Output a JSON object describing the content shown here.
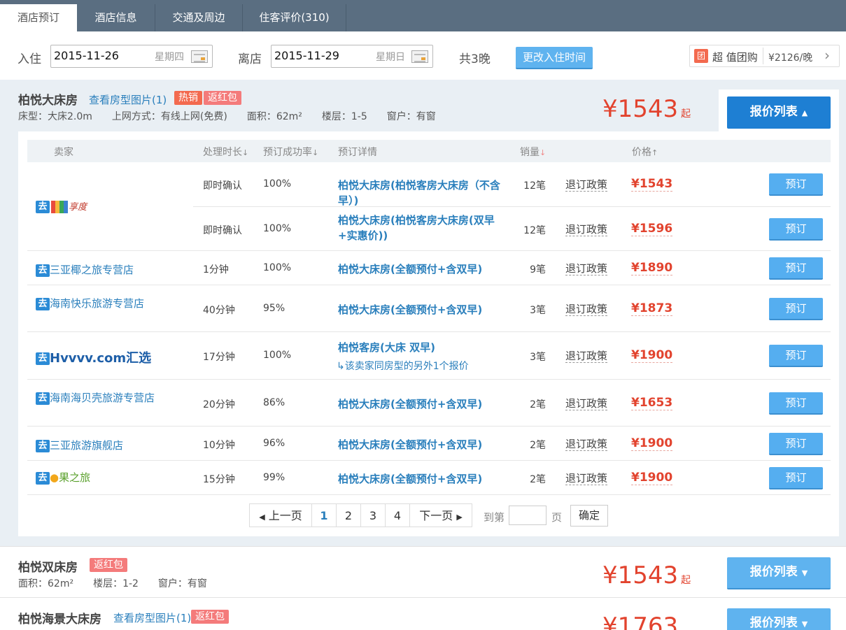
{
  "tabs": [
    {
      "label": "酒店预订"
    },
    {
      "label": "酒店信息"
    },
    {
      "label": "交通及周边"
    },
    {
      "label": "住客评价(310)"
    }
  ],
  "dates": {
    "checkin_label": "入住",
    "checkin_date": "2015-11-26",
    "checkin_weekday": "星期四",
    "checkout_label": "离店",
    "checkout_date": "2015-11-29",
    "checkout_weekday": "星期日",
    "nights": "共3晚",
    "change_button": "更改入住时间"
  },
  "promo": {
    "icon": "团",
    "label": "超 值团购",
    "price": "¥2126/晚"
  },
  "room1": {
    "name": "柏悦大床房",
    "view_photos": "查看房型图片(1)",
    "tag_hot": "热销",
    "tag_redpack": "返红包",
    "specs": "床型：大床2.0m　　上网方式：有线上网(免费)　　面积：62m²　　楼层：1-5　　窗户：有窗",
    "price": "¥1543",
    "price_suffix": "起",
    "quote_button": "报价列表"
  },
  "table": {
    "headers": {
      "seller": "卖家",
      "time": "处理时长",
      "rate": "预订成功率",
      "detail": "预订详情",
      "sales": "销量",
      "price": "价格"
    },
    "book_label": "预订",
    "policy_label": "退订政策",
    "rows": [
      {
        "seller": "享度",
        "time": "即时确认",
        "rate": "100%",
        "detail": "柏悦大床房(柏悦客房大床房（不含早）)",
        "sales": "12笔",
        "price": "¥1543"
      },
      {
        "seller": "",
        "time": "即时确认",
        "rate": "100%",
        "detail": "柏悦大床房(柏悦客房大床房(双早+实惠价))",
        "sales": "12笔",
        "price": "¥1596"
      },
      {
        "seller": "三亚椰之旅专营店",
        "time": "1分钟",
        "rate": "100%",
        "detail": "柏悦大床房(全额预付+含双早)",
        "sales": "9笔",
        "price": "¥1890"
      },
      {
        "seller": "海南快乐旅游专营店",
        "time": "40分钟",
        "rate": "95%",
        "detail": "柏悦大床房(全额预付+含双早)",
        "sales": "3笔",
        "price": "¥1873"
      },
      {
        "seller": "Hvvvv.com汇选",
        "time": "17分钟",
        "rate": "100%",
        "detail": "柏悦客房(大床 双早)",
        "sub": "↳该卖家同房型的另外1个报价",
        "sales": "3笔",
        "price": "¥1900"
      },
      {
        "seller": "海南海贝壳旅游专营店",
        "time": "20分钟",
        "rate": "86%",
        "detail": "柏悦大床房(全额预付+含双早)",
        "sales": "2笔",
        "price": "¥1653"
      },
      {
        "seller": "三亚旅游旗舰店",
        "time": "10分钟",
        "rate": "96%",
        "detail": "柏悦大床房(全额预付+含双早)",
        "sales": "2笔",
        "price": "¥1900"
      },
      {
        "seller": "果之旅",
        "time": "15分钟",
        "rate": "99%",
        "detail": "柏悦大床房(全额预付+含双早)",
        "sales": "2笔",
        "price": "¥1900"
      }
    ]
  },
  "pagination": {
    "prev": "上一页",
    "pages": [
      "1",
      "2",
      "3",
      "4"
    ],
    "next": "下一页",
    "goto": "到第",
    "page_unit": "页",
    "confirm": "确定"
  },
  "room2": {
    "name": "柏悦双床房",
    "tag_redpack": "返红包",
    "specs": "面积：62m²　　楼层：1-2　　窗户：有窗",
    "price": "¥1543",
    "price_suffix": "起",
    "quote_button": "报价列表"
  },
  "room3": {
    "name": "柏悦海景大床房",
    "view_photos": "查看房型图片(1)",
    "tag_redpack": "返红包",
    "price": "¥1763",
    "quote_button": "报价列表"
  },
  "colors": {
    "accent": "#2a7fbc",
    "price": "#e2432e",
    "button": "#55aef0",
    "tab_bar": "#5a6e81"
  }
}
